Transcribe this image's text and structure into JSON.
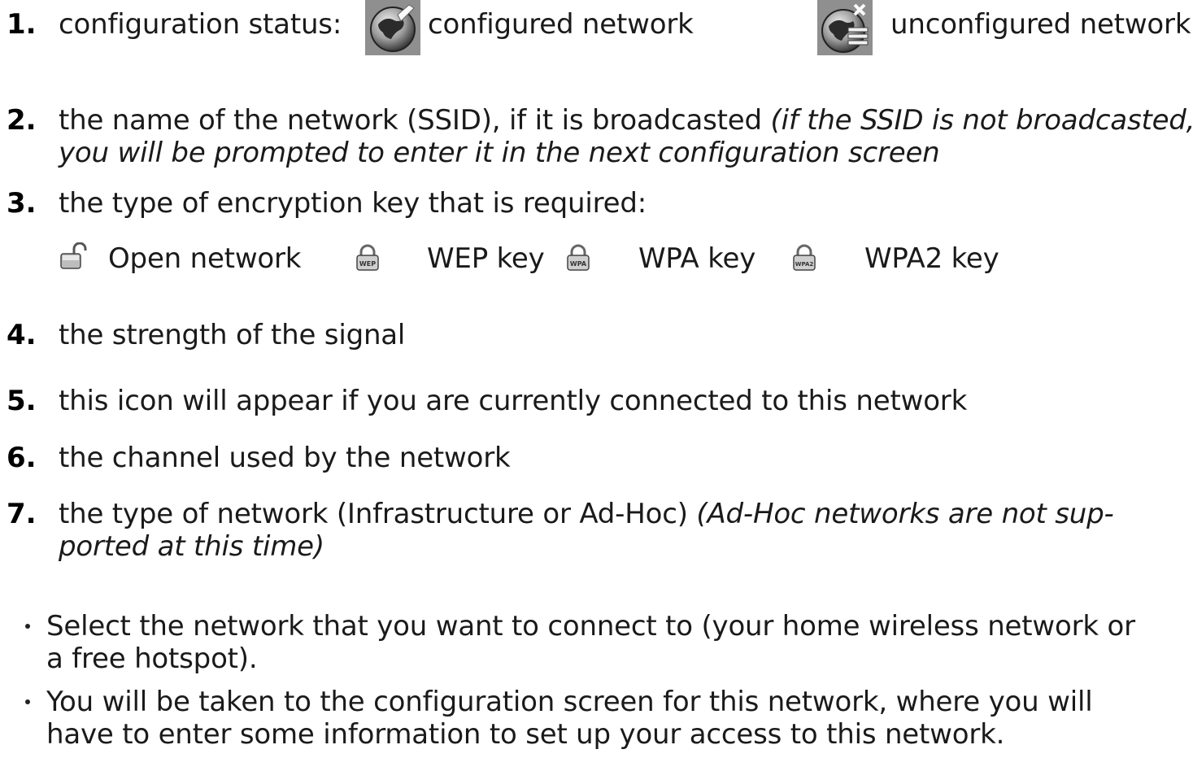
{
  "items": [
    {
      "num": "1.",
      "label": "configuration status:",
      "configured": "configured network",
      "unconfigured": "unconfigured network"
    },
    {
      "num": "2.",
      "line1_plain": "the name of the network (SSID), if it is broadcasted ",
      "line1_italic": "(if the SSID is not broadcasted,",
      "line2_italic": "you will be prompted to enter it in the next configuration screen"
    },
    {
      "num": "3.",
      "text": "the type of encryption key that is required:",
      "keys": [
        "Open network",
        "WEP key",
        "WPA key",
        "WPA2 key"
      ],
      "key_icon_text": [
        "WEP",
        "WPA",
        "WPA2"
      ]
    },
    {
      "num": "4.",
      "text": "the strength of the signal"
    },
    {
      "num": "5.",
      "text": "this icon will appear if you are currently connected to this network"
    },
    {
      "num": "6.",
      "text": "the channel used by the network"
    },
    {
      "num": "7.",
      "line1_plain": "the type of network (Infrastructure or Ad-Hoc) ",
      "line1_italic": "(Ad-Hoc networks are not sup-",
      "line2_italic": "ported at this time)"
    }
  ],
  "bullets": [
    {
      "line1": "Select the network that you want to connect to (your home wireless network or",
      "line2": "a free hotspot)."
    },
    {
      "line1": "You will be taken to the configuration screen for this network, where you will",
      "line2": "have to enter some information to set up your access to this network."
    }
  ]
}
